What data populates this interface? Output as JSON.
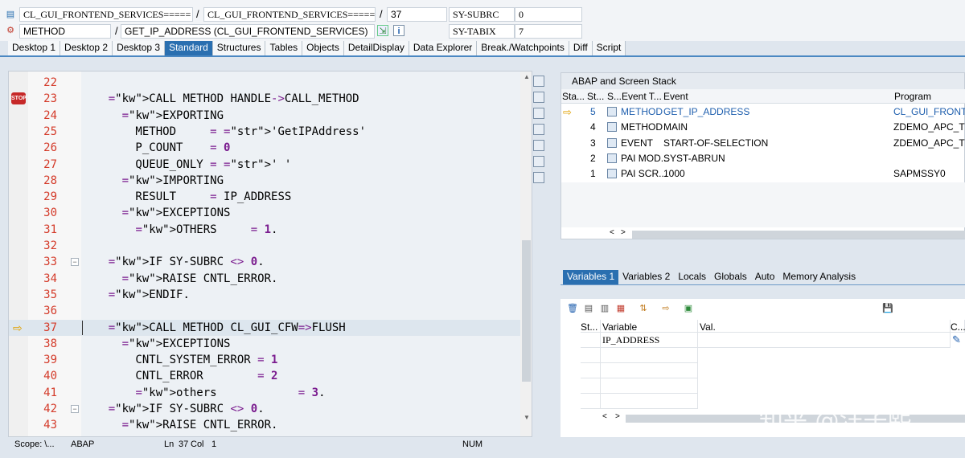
{
  "header": {
    "class_field_1": "CL_GUI_FRONTEND_SERVICES=====",
    "class_field_2": "CL_GUI_FRONTEND_SERVICES=====",
    "separator": "/",
    "line_number": "37",
    "sy_subrc_label": "SY-SUBRC",
    "sy_subrc_value": "0",
    "kind_field": "METHOD",
    "method_field": "GET_IP_ADDRESS (CL_GUI_FRONTEND_SERVICES)",
    "sy_tabix_label": "SY-TABIX",
    "sy_tabix_value": "7"
  },
  "tabs": [
    "Desktop 1",
    "Desktop 2",
    "Desktop 3",
    "Standard",
    "Structures",
    "Tables",
    "Objects",
    "DetailDisplay",
    "Data Explorer",
    "Break./Watchpoints",
    "Diff",
    "Script"
  ],
  "active_tab": "Standard",
  "code": {
    "lines": [
      {
        "n": "22",
        "t": ""
      },
      {
        "n": "23",
        "t": "    CALL METHOD HANDLE->CALL_METHOD"
      },
      {
        "n": "24",
        "t": "      EXPORTING"
      },
      {
        "n": "25",
        "t": "        METHOD     = 'GetIPAddress'"
      },
      {
        "n": "26",
        "t": "        P_COUNT    = 0"
      },
      {
        "n": "27",
        "t": "        QUEUE_ONLY = ' '"
      },
      {
        "n": "28",
        "t": "      IMPORTING"
      },
      {
        "n": "29",
        "t": "        RESULT     = IP_ADDRESS"
      },
      {
        "n": "30",
        "t": "      EXCEPTIONS"
      },
      {
        "n": "31",
        "t": "        OTHERS     = 1."
      },
      {
        "n": "32",
        "t": ""
      },
      {
        "n": "33",
        "t": "    IF SY-SUBRC <> 0."
      },
      {
        "n": "34",
        "t": "      RAISE CNTL_ERROR."
      },
      {
        "n": "35",
        "t": "    ENDIF."
      },
      {
        "n": "36",
        "t": ""
      },
      {
        "n": "37",
        "t": "    CALL METHOD CL_GUI_CFW=>FLUSH"
      },
      {
        "n": "38",
        "t": "      EXCEPTIONS"
      },
      {
        "n": "39",
        "t": "        CNTL_SYSTEM_ERROR = 1"
      },
      {
        "n": "40",
        "t": "        CNTL_ERROR        = 2"
      },
      {
        "n": "41",
        "t": "        others            = 3."
      },
      {
        "n": "42",
        "t": "    IF SY-SUBRC <> 0."
      },
      {
        "n": "43",
        "t": "      RAISE CNTL_ERROR."
      }
    ],
    "breakpoint_icon": "stop-breakpoint-icon",
    "current_line_icon": "arrow-right-icon"
  },
  "stack": {
    "title": "ABAP and Screen Stack",
    "columns": [
      "Sta...",
      "St...",
      "S...",
      "Event T...",
      "Event",
      "Program"
    ],
    "rows": [
      {
        "level": "5",
        "type": "METHOD",
        "event": "GET_IP_ADDRESS",
        "program": "CL_GUI_FRONTEN",
        "current": true
      },
      {
        "level": "4",
        "type": "METHOD",
        "event": "MAIN",
        "program": "ZDEMO_APC_TCP_",
        "current": false
      },
      {
        "level": "3",
        "type": "EVENT",
        "event": "START-OF-SELECTION",
        "program": "ZDEMO_APC_TCP_",
        "current": false
      },
      {
        "level": "2",
        "type": "PAI MOD...",
        "event": "SYST-ABRUN",
        "program": "",
        "current": false
      },
      {
        "level": "1",
        "type": "PAI SCR...",
        "event": "1000",
        "program": "SAPMSSY0",
        "current": false
      }
    ]
  },
  "var_tabs": [
    "Variables 1",
    "Variables 2",
    "Locals",
    "Globals",
    "Auto",
    "Memory Analysis"
  ],
  "var_active": "Variables 1",
  "vars": {
    "columns": [
      "St...",
      "Variable",
      "Val.",
      "C..."
    ],
    "rows": [
      {
        "name": "IP_ADDRESS",
        "value": ""
      }
    ]
  },
  "status": {
    "scope": "Scope: \\...",
    "lang": "ABAP",
    "pos_label": "Ln",
    "ln": "37",
    "col_label": "Col",
    "col": "1",
    "num": "NUM"
  },
  "watermark": "知乎 @汪子熙",
  "colors": {
    "accent": "#2a6fb0",
    "keyword": "#1d8a2a",
    "string": "#0a2fa3",
    "number": "#7a1b8e",
    "line_number": "#d43b2a"
  }
}
